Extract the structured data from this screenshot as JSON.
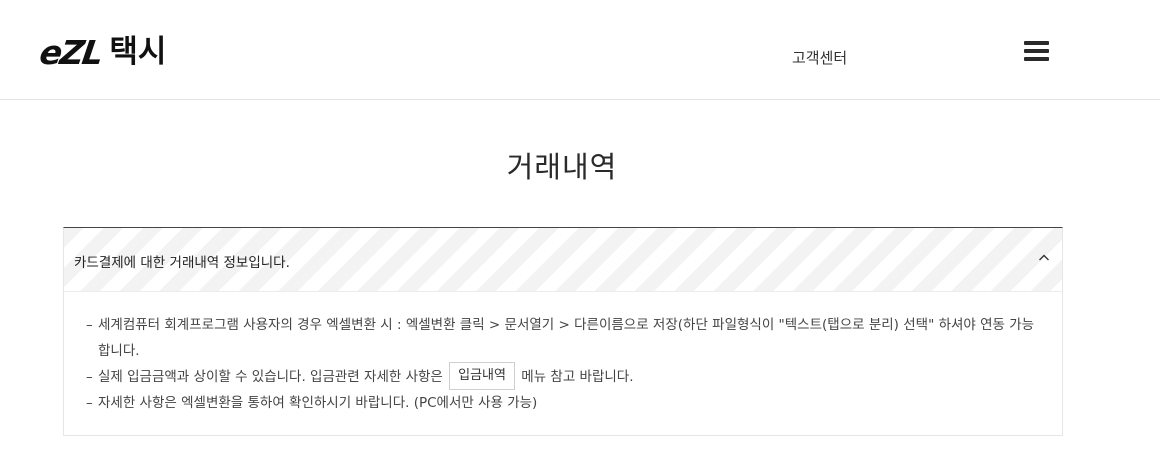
{
  "header": {
    "logo_mark": "eZL",
    "logo_sub": "택시",
    "customer_center": "고객센터",
    "menu_icon": "hamburger-menu-icon"
  },
  "main": {
    "title": "거래내역",
    "panel": {
      "heading": "카드결제에 대한 거래내역 정보입니다.",
      "toggle_icon": "chevron-up-icon",
      "notes": [
        {
          "dash": "–",
          "text": "세계컴퓨터 회계프로그램 사용자의 경우 엑셀변환 시 : 엑셀변환 클릭 > 문서열기 > 다른이름으로 저장(하단 파일형식이 \"텍스트(탭으로 분리) 선택\" 하셔야 연동 가능합니다."
        },
        {
          "dash": "–",
          "text_before": "실제 입금금액과 상이할 수 있습니다. 입금관련 자세한 사항은",
          "button": "입금내역",
          "text_after": "메뉴 참고 바랍니다."
        },
        {
          "dash": "–",
          "text": "자세한 사항은 엑셀변환을 통하여 확인하시기 바랍니다. (PC에서만 사용 가능)"
        }
      ]
    }
  },
  "colors": {
    "header_border": "#e3e3e3",
    "panel_top_border": "#444444",
    "stripe": "#f3f3f3"
  }
}
